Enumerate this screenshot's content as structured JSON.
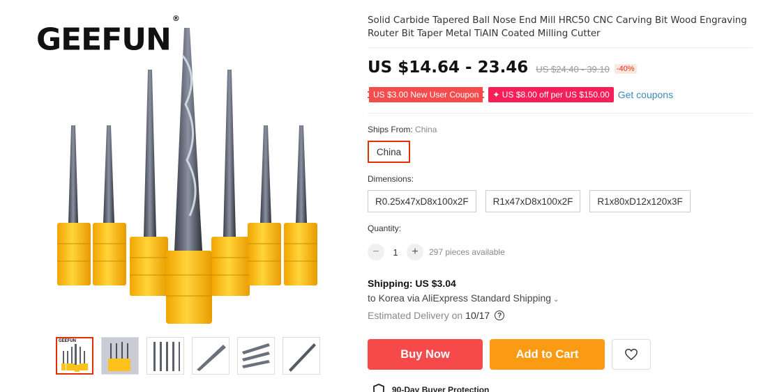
{
  "gallery": {
    "logo_text": "GEEFUN",
    "logo_mark": "®",
    "thumb_logo": "GEEFUN",
    "thumbnails": [
      "thumb-1",
      "thumb-2",
      "thumb-3",
      "thumb-4",
      "thumb-5",
      "thumb-6"
    ]
  },
  "product": {
    "title": "Solid Carbide Tapered Ball Nose End Mill HRC50 CNC Carving Bit Wood Engraving Router Bit Taper Metal TiAIN Coated Milling Cutter",
    "price": "US $14.64 - 23.46",
    "original_price": "US $24.40 - 39.10",
    "discount": "-40%"
  },
  "coupons": {
    "new_user": "US $3.00 New User Coupon",
    "store": "✦ US $8.00 off per US $150.00",
    "get_label": "Get coupons"
  },
  "ships_from": {
    "label": "Ships From:",
    "value": "China",
    "option": "China"
  },
  "dimensions": {
    "label": "Dimensions:",
    "options": [
      "R0.25x47xD8x100x2F",
      "R1x47xD8x100x2F",
      "R1x80xD12x120x3F"
    ]
  },
  "quantity": {
    "label": "Quantity:",
    "minus": "−",
    "value": "1",
    "plus": "+",
    "available": "297 pieces available"
  },
  "shipping": {
    "label": "Shipping: US $3.04",
    "route": "to Korea via AliExpress Standard Shipping",
    "caret": "⌄",
    "delivery_label": "Estimated Delivery on",
    "delivery_date": "10/17",
    "help": "?"
  },
  "actions": {
    "buy": "Buy Now",
    "cart": "Add to Cart"
  },
  "protection": {
    "label": "90-Day Buyer Protection"
  },
  "colors": {
    "accent_red": "#e62e04",
    "buy": "#f5494a",
    "cart": "#fb9a13",
    "link": "#3a8ab8",
    "holder_yellow": "#ffc21a"
  }
}
